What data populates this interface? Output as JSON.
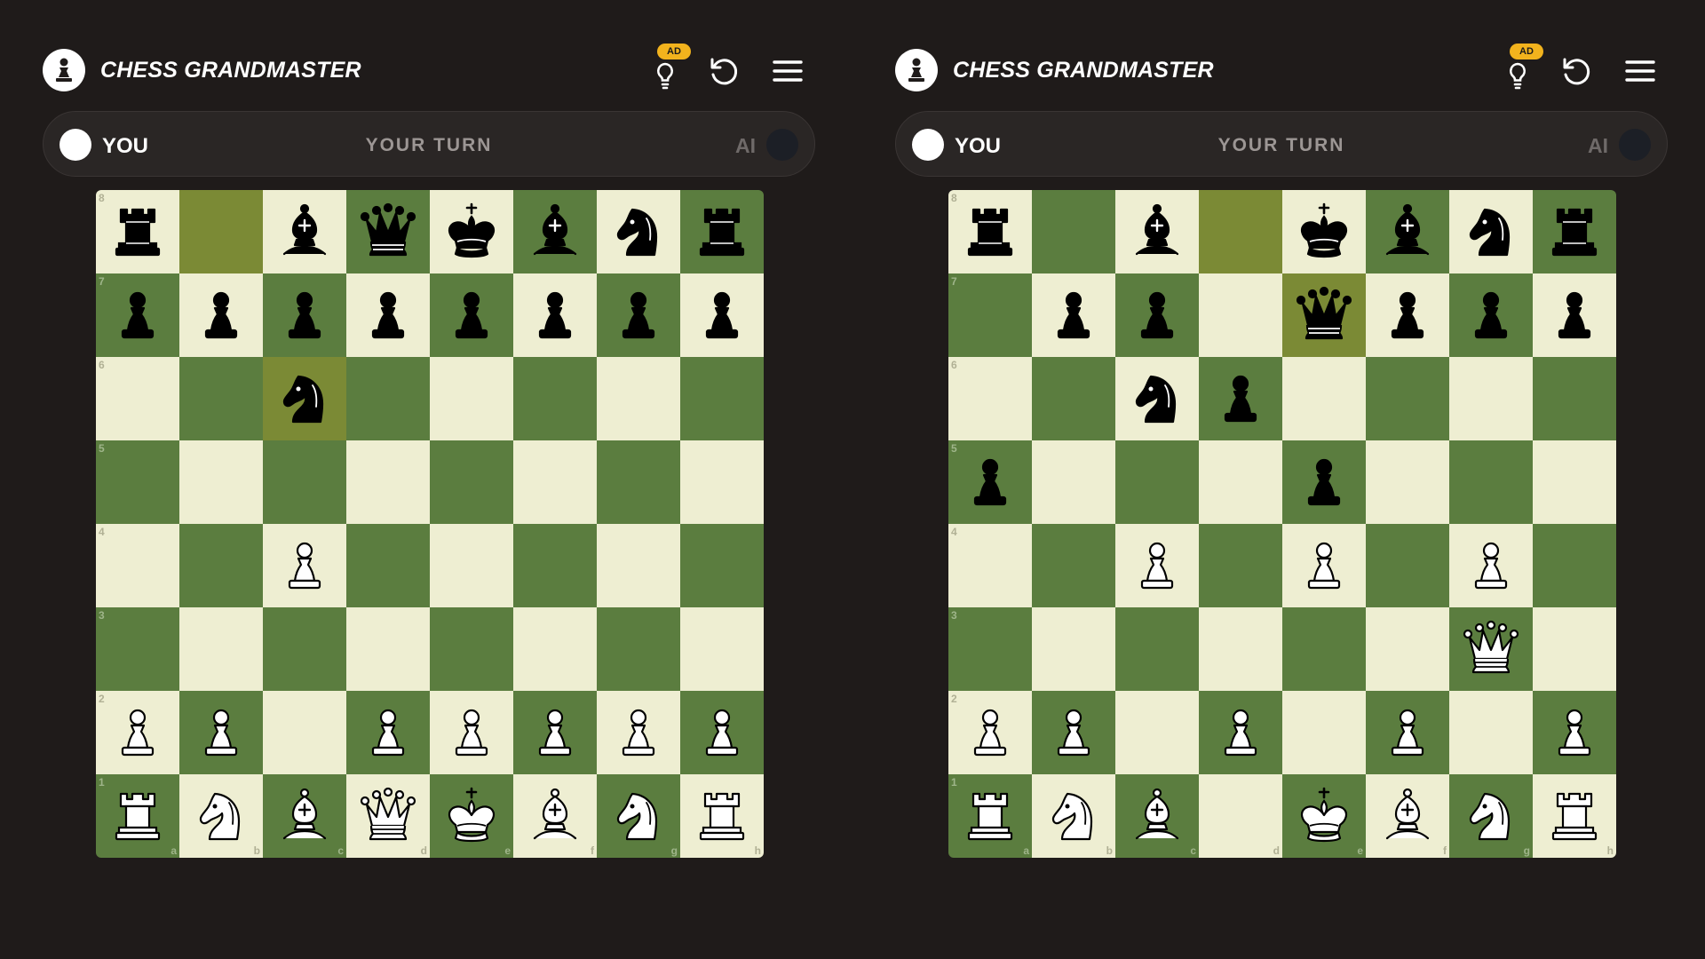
{
  "app": {
    "title": "CHESS GRANDMASTER",
    "ad_badge": "AD"
  },
  "status": {
    "player": "YOU",
    "turn": "YOUR TURN",
    "opponent": "AI"
  },
  "colors": {
    "light_square": "#eeeed2",
    "dark_square": "#5b7d3f",
    "highlight": "#7b8a35",
    "badge": "#f2b31d"
  },
  "icons": {
    "logo": "pawn-icon",
    "hint": "lightbulb-icon",
    "restart": "restart-icon",
    "menu": "hamburger-menu-icon"
  },
  "files": [
    "a",
    "b",
    "c",
    "d",
    "e",
    "f",
    "g",
    "h"
  ],
  "ranks": [
    "8",
    "7",
    "6",
    "5",
    "4",
    "3",
    "2",
    "1"
  ],
  "boards": [
    {
      "highlights": [
        "b8",
        "c6"
      ],
      "rows": [
        [
          "br",
          "",
          "bb",
          "bq",
          "bk",
          "bb",
          "bn",
          "br"
        ],
        [
          "bp",
          "bp",
          "bp",
          "bp",
          "bp",
          "bp",
          "bp",
          "bp"
        ],
        [
          "",
          "",
          "bn",
          "",
          "",
          "",
          "",
          ""
        ],
        [
          "",
          "",
          "",
          "",
          "",
          "",
          "",
          ""
        ],
        [
          "",
          "",
          "wp",
          "",
          "",
          "",
          "",
          ""
        ],
        [
          "",
          "",
          "",
          "",
          "",
          "",
          "",
          ""
        ],
        [
          "wp",
          "wp",
          "",
          "wp",
          "wp",
          "wp",
          "wp",
          "wp"
        ],
        [
          "wr",
          "wn",
          "wb",
          "wq",
          "wk",
          "wb",
          "wn",
          "wr"
        ]
      ]
    },
    {
      "highlights": [
        "d8",
        "e7"
      ],
      "rows": [
        [
          "br",
          "",
          "bb",
          "",
          "bk",
          "bb",
          "bn",
          "br"
        ],
        [
          "",
          "bp",
          "bp",
          "",
          "bq",
          "bp",
          "bp",
          "bp"
        ],
        [
          "",
          "",
          "bn",
          "bp",
          "",
          "",
          "",
          ""
        ],
        [
          "bp",
          "",
          "",
          "",
          "bp",
          "",
          "",
          ""
        ],
        [
          "",
          "",
          "wp",
          "",
          "wp",
          "",
          "wp",
          ""
        ],
        [
          "",
          "",
          "",
          "",
          "",
          "",
          "wq",
          ""
        ],
        [
          "wp",
          "wp",
          "",
          "wp",
          "",
          "wp",
          "",
          "wp"
        ],
        [
          "wr",
          "wn",
          "wb",
          "",
          "wk",
          "wb",
          "wn",
          "wr"
        ]
      ]
    }
  ]
}
